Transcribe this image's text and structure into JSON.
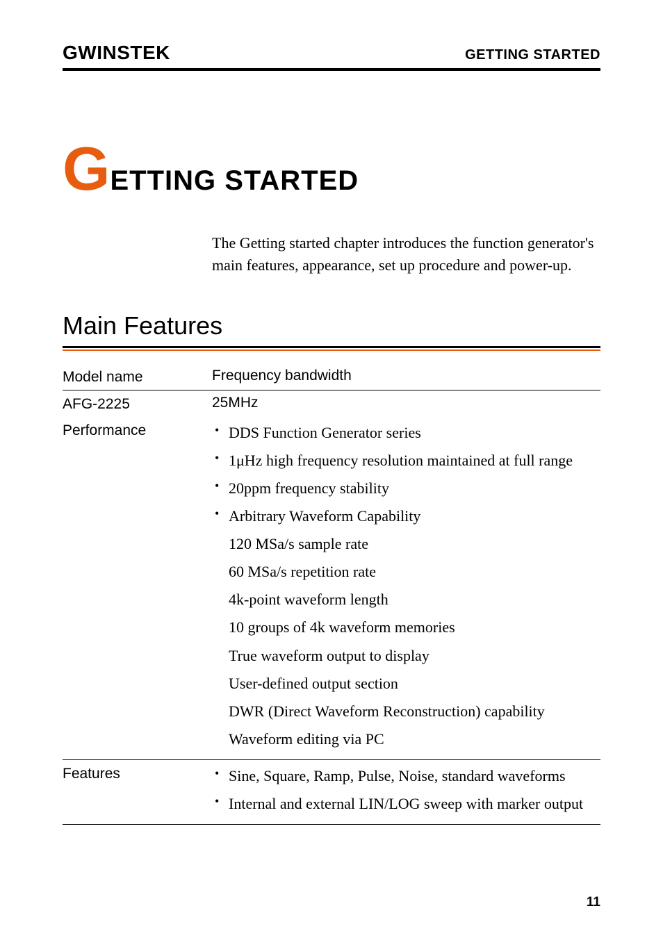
{
  "header": {
    "logo_text": "GWINSTEK",
    "right_text": "GETTING STARTED"
  },
  "chapter": {
    "drop_cap": "G",
    "title_rest": "ETTING STARTED",
    "intro": "The Getting started chapter introduces the function generator's main features, appearance, set up procedure and power-up."
  },
  "section": {
    "title": "Main Features"
  },
  "table": {
    "header_row": {
      "label": "Model name",
      "value": "Frequency bandwidth"
    },
    "model_row": {
      "label": "AFG-2225",
      "value": "25MHz"
    },
    "performance": {
      "label": "Performance",
      "bullets": [
        "DDS Function Generator series",
        "1μHz high frequency resolution maintained at full range",
        "20ppm frequency stability",
        "Arbitrary Waveform Capability"
      ],
      "sub_items": [
        "120 MSa/s sample rate",
        "60 MSa/s repetition rate",
        "4k-point waveform length",
        "10 groups of 4k waveform memories",
        "True waveform output to display",
        "User-defined output section",
        "DWR (Direct Waveform Reconstruction) capability",
        "Waveform editing via PC"
      ]
    },
    "features": {
      "label": "Features",
      "bullets": [
        "Sine, Square, Ramp, Pulse, Noise, standard waveforms",
        "Internal and external LIN/LOG sweep with marker output"
      ]
    }
  },
  "page_number": "11"
}
